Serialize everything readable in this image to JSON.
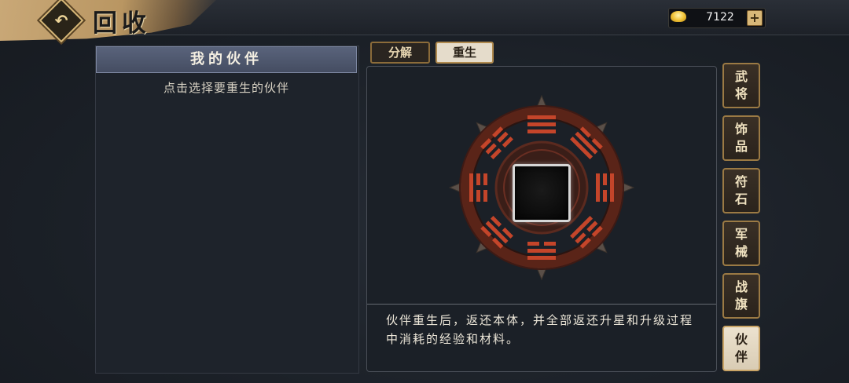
{
  "header": {
    "title": "回收",
    "back_icon": "back-arrow-icon",
    "currency": {
      "icon": "gold-ingot-icon",
      "value": "7122",
      "add_icon": "plus-icon"
    }
  },
  "left_panel": {
    "title": "我的伙伴",
    "hint": "点击选择要重生的伙伴"
  },
  "tabs": [
    {
      "label": "分解",
      "active": false
    },
    {
      "label": "重生",
      "active": true
    }
  ],
  "center": {
    "emblem": "bagua-emblem",
    "description": "伙伴重生后，返还本体，并全部返还升星和升级过程中消耗的经验和材料。"
  },
  "side_tabs": [
    {
      "chars": [
        "武",
        "将"
      ],
      "active": false
    },
    {
      "chars": [
        "饰",
        "品"
      ],
      "active": false
    },
    {
      "chars": [
        "符",
        "石"
      ],
      "active": false
    },
    {
      "chars": [
        "军",
        "械"
      ],
      "active": false
    },
    {
      "chars": [
        "战",
        "旗"
      ],
      "active": false
    },
    {
      "chars": [
        "伙",
        "伴"
      ],
      "active": true
    }
  ],
  "colors": {
    "accent_gold": "#d8b878",
    "bagua_red": "#c4452a",
    "panel_header": "#59637b"
  }
}
